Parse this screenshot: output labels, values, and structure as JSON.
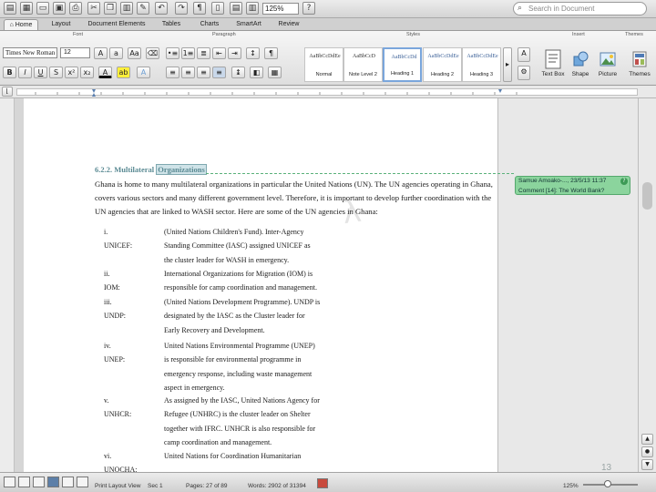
{
  "toolbar": {
    "zoom": "125%",
    "search_placeholder": "Search in Document"
  },
  "ribbon_tabs": [
    {
      "label": "Home"
    },
    {
      "label": "Layout"
    },
    {
      "label": "Document Elements"
    },
    {
      "label": "Tables"
    },
    {
      "label": "Charts"
    },
    {
      "label": "SmartArt"
    },
    {
      "label": "Review"
    }
  ],
  "ribbon": {
    "groups": {
      "font": "Font",
      "paragraph": "Paragraph",
      "styles": "Styles",
      "insert": "Insert",
      "themes": "Themes"
    },
    "font_name": "Times New Roman",
    "font_size": "12",
    "styles": [
      {
        "sample": "AaBbCcDdEe",
        "name": "Normal"
      },
      {
        "sample": "AaBbCcD",
        "name": "Note Level 2"
      },
      {
        "sample": "AaBbCcDd",
        "name": "Heading 1"
      },
      {
        "sample": "AaBbCcDdEe",
        "name": "Heading 2"
      },
      {
        "sample": "AaBbCcDdEe",
        "name": "Heading 3"
      }
    ],
    "insert": [
      {
        "label": "Text Box"
      },
      {
        "label": "Shape"
      },
      {
        "label": "Picture"
      },
      {
        "label": "Themes"
      }
    ]
  },
  "document": {
    "heading_number": "6.2.2. Multilateral ",
    "heading_highlight": "Organizations",
    "paragraph": "Ghana is home to many multilateral organizations in particular the United Nations (UN). The UN agencies operating in Ghana,\ncovers various sectors and many different government level. Therefore, it is important to develop further coordination with the\nUN agencies that are linked to WASH sector. Here are some of the UN agencies in Ghana:",
    "agencies": [
      {
        "label": "i.     UNICEF:",
        "desc": "(United Nations Children's Fund). Inter-Agency\nStanding Committee (IASC) assigned UNICEF as\nthe cluster leader for WASH in emergency."
      },
      {
        "label": "ii.   IOM:",
        "desc": "International Organizations for Migration (IOM) is\nresponsible for camp coordination and management."
      },
      {
        "label": "iii.  UNDP:",
        "desc": "(United Nations Development Programme). UNDP is\ndesignated by the IASC as the Cluster leader for\nEarly Recovery and Development."
      },
      {
        "label": "iv.  UNEP:",
        "desc": "United Nations Environmental Programme (UNEP)\nis responsible for environmental programme in\nemergency response, including waste management\naspect in emergency."
      },
      {
        "label": "v.   UNHCR:",
        "desc": "As assigned by the IASC, United Nations Agency for\nRefugee (UNHRC) is the cluster leader on Shelter\ntogether with IFRC. UNHCR is also responsible for\ncamp coordination and management."
      },
      {
        "label": "vi.  UNOCHA:",
        "desc": "United Nations for Coordination Humanitarian"
      }
    ]
  },
  "comment": {
    "author": "Samue Amoako-..., 23/5/13 11:37",
    "text": "Comment [14]: The World Bank?"
  },
  "status": {
    "section": "Sec    1",
    "pages": "Pages:    27 of 89",
    "words": "Words:    2902 of 31394",
    "view": "Print Layout View",
    "zoom": "125%",
    "page_number": "13"
  }
}
